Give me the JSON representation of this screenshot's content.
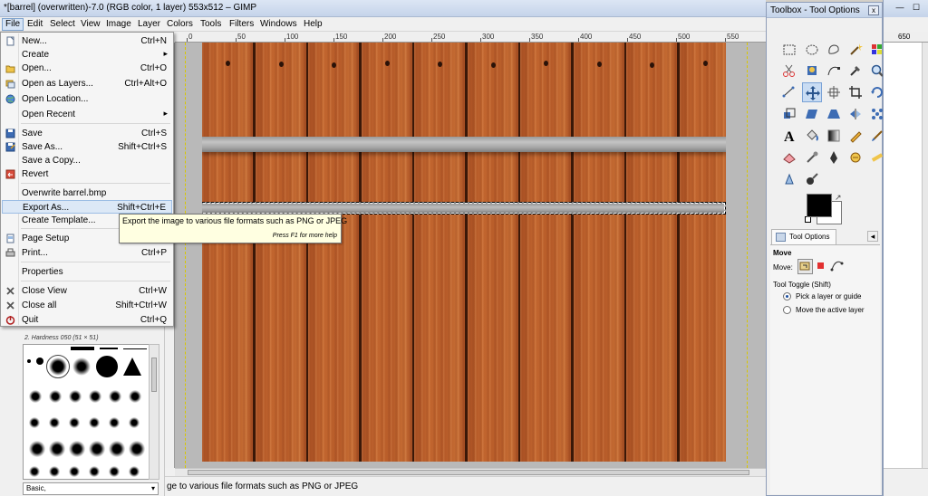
{
  "main_window": {
    "title": "*[barrel] (overwritten)-7.0 (RGB color, 1 layer) 553x512 – GIMP"
  },
  "menubar": [
    {
      "label": "File"
    },
    {
      "label": "Edit"
    },
    {
      "label": "Select"
    },
    {
      "label": "View"
    },
    {
      "label": "Image"
    },
    {
      "label": "Layer"
    },
    {
      "label": "Colors"
    },
    {
      "label": "Tools"
    },
    {
      "label": "Filters"
    },
    {
      "label": "Windows"
    },
    {
      "label": "Help"
    }
  ],
  "file_menu": {
    "items": [
      {
        "label": "New...",
        "shortcut": "Ctrl+N",
        "icon": "new-document-icon"
      },
      {
        "label": "Create",
        "shortcut": "",
        "icon": "",
        "submenu": true
      },
      {
        "label": "Open...",
        "shortcut": "Ctrl+O",
        "icon": "open-folder-icon"
      },
      {
        "label": "Open as Layers...",
        "shortcut": "Ctrl+Alt+O",
        "icon": "open-layers-icon"
      },
      {
        "label": "Open Location...",
        "shortcut": "",
        "icon": "globe-icon"
      },
      {
        "label": "Open Recent",
        "shortcut": "",
        "icon": "",
        "submenu": true
      },
      {
        "label": "Save",
        "shortcut": "Ctrl+S",
        "icon": "save-icon"
      },
      {
        "label": "Save As...",
        "shortcut": "Shift+Ctrl+S",
        "icon": "save-as-icon"
      },
      {
        "label": "Save a Copy...",
        "shortcut": "",
        "icon": ""
      },
      {
        "label": "Revert",
        "shortcut": "",
        "icon": "revert-icon"
      },
      {
        "label": "Overwrite barrel.bmp",
        "shortcut": "",
        "icon": ""
      },
      {
        "label": "Export As...",
        "shortcut": "Shift+Ctrl+E",
        "icon": "",
        "highlighted": true
      },
      {
        "label": "Create Template...",
        "shortcut": "",
        "icon": ""
      },
      {
        "label": "Page Setup",
        "shortcut": "",
        "icon": "page-setup-icon"
      },
      {
        "label": "Print...",
        "shortcut": "Ctrl+P",
        "icon": "print-icon"
      },
      {
        "label": "Properties",
        "shortcut": "",
        "icon": ""
      },
      {
        "label": "Close View",
        "shortcut": "Ctrl+W",
        "icon": "close-icon"
      },
      {
        "label": "Close all",
        "shortcut": "Shift+Ctrl+W",
        "icon": "close-icon"
      },
      {
        "label": "Quit",
        "shortcut": "Ctrl+Q",
        "icon": "quit-icon"
      }
    ]
  },
  "tooltip": {
    "text": "Export the image to various file formats such as PNG or JPEG",
    "hint": "Press F1 for more help"
  },
  "rulers": {
    "top_ticks": [
      "0",
      "50",
      "100",
      "150",
      "200",
      "250",
      "300",
      "350",
      "400",
      "450",
      "500",
      "550"
    ],
    "right_tick": "650"
  },
  "brushes": {
    "current": "2. Hardness 050 (51 × 51)",
    "preset": "Basic,"
  },
  "statusbar": {
    "text": "ge to various file formats such as PNG or JPEG"
  },
  "toolbox": {
    "title": "Toolbox - Tool Options",
    "close_label": "x",
    "tools": [
      "rect-select-icon",
      "ellipse-select-icon",
      "free-select-icon",
      "fuzzy-select-icon",
      "select-by-color-icon",
      "scissors-icon",
      "foreground-select-icon",
      "paths-icon",
      "color-picker-icon",
      "zoom-icon",
      "measure-icon",
      "move-icon",
      "align-icon",
      "crop-icon",
      "rotate-icon",
      "scale-icon",
      "shear-icon",
      "perspective-icon",
      "flip-icon",
      "cage-icon",
      "text-icon",
      "bucket-fill-icon",
      "blend-icon",
      "pencil-icon",
      "paintbrush-icon",
      "eraser-icon",
      "airbrush-icon",
      "ink-icon",
      "clone-icon",
      "heal-icon",
      "smudge-icon",
      "dodge-burn-icon"
    ],
    "active_tool_index": 11,
    "colors": {
      "foreground": "#000000",
      "background": "#ffffff"
    }
  },
  "tool_options": {
    "tab_label": "Tool Options",
    "title": "Move",
    "move_label": "Move:",
    "move_modes": [
      "layer-mode-icon",
      "selection-mode-icon",
      "path-mode-icon"
    ],
    "active_move_mode": 0,
    "toggle_label": "Tool Toggle  (Shift)",
    "options": [
      {
        "label": "Pick a layer or guide",
        "checked": true
      },
      {
        "label": "Move the active layer",
        "checked": false
      }
    ]
  },
  "colors": {
    "wood": "#b4582a",
    "menu_highlight": "#dce8f6",
    "tooltip_bg": "#ffffe1"
  }
}
